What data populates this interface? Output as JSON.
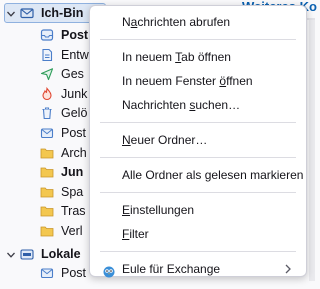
{
  "tree": {
    "account_label": "Ich-Bin",
    "items": [
      {
        "label": "Post",
        "icon": "inbox-icon",
        "bold": true
      },
      {
        "label": "Entw",
        "icon": "drafts-icon",
        "bold": false
      },
      {
        "label": "Ges",
        "icon": "sent-icon",
        "bold": false
      },
      {
        "label": "Junk",
        "icon": "junk-icon",
        "bold": false
      },
      {
        "label": "Gelö",
        "icon": "trash-icon",
        "bold": false
      },
      {
        "label": "Post",
        "icon": "outbox-icon",
        "bold": false
      },
      {
        "label": "Arch",
        "icon": "folder-icon",
        "bold": false
      },
      {
        "label": "Jun",
        "icon": "folder-icon",
        "bold": true
      },
      {
        "label": "Spa",
        "icon": "folder-icon",
        "bold": false
      },
      {
        "label": "Tras",
        "icon": "folder-icon",
        "bold": false
      },
      {
        "label": "Verl",
        "icon": "folder-icon",
        "bold": false
      }
    ],
    "local_label": "Lokale",
    "local_items": [
      {
        "label": "Post",
        "icon": "outbox-icon",
        "bold": false
      }
    ]
  },
  "right_title": "Weiteres Ko",
  "menu": {
    "items": [
      {
        "pre": "N",
        "acc": "a",
        "post": "chrichten abrufen",
        "sep_after": true
      },
      {
        "pre": "In neuem ",
        "acc": "T",
        "post": "ab öffnen",
        "sep_after": false
      },
      {
        "pre": "In neuem Fenster ",
        "acc": "ö",
        "post": "ffnen",
        "sep_after": false
      },
      {
        "pre": "Nachrichten ",
        "acc": "s",
        "post": "uchen…",
        "sep_after": true
      },
      {
        "pre": "",
        "acc": "N",
        "post": "euer Ordner…",
        "sep_after": true
      },
      {
        "pre": "Alle Ordner als ",
        "acc": "g",
        "post": "elesen markieren",
        "sep_after": true
      },
      {
        "pre": "",
        "acc": "E",
        "post": "instellungen",
        "sep_after": false
      },
      {
        "pre": "",
        "acc": "F",
        "post": "ilter",
        "sep_after": true
      },
      {
        "pre": "Eule für Exchange",
        "acc": "",
        "post": "",
        "sep_after": false,
        "icon": "owl-icon",
        "submenu": true
      }
    ]
  },
  "colors": {
    "accent": "#0a61b1",
    "selection_bg": "#dde7f5",
    "folder_yellow": "#f3c74f",
    "inbox_blue": "#4b7ec9"
  }
}
